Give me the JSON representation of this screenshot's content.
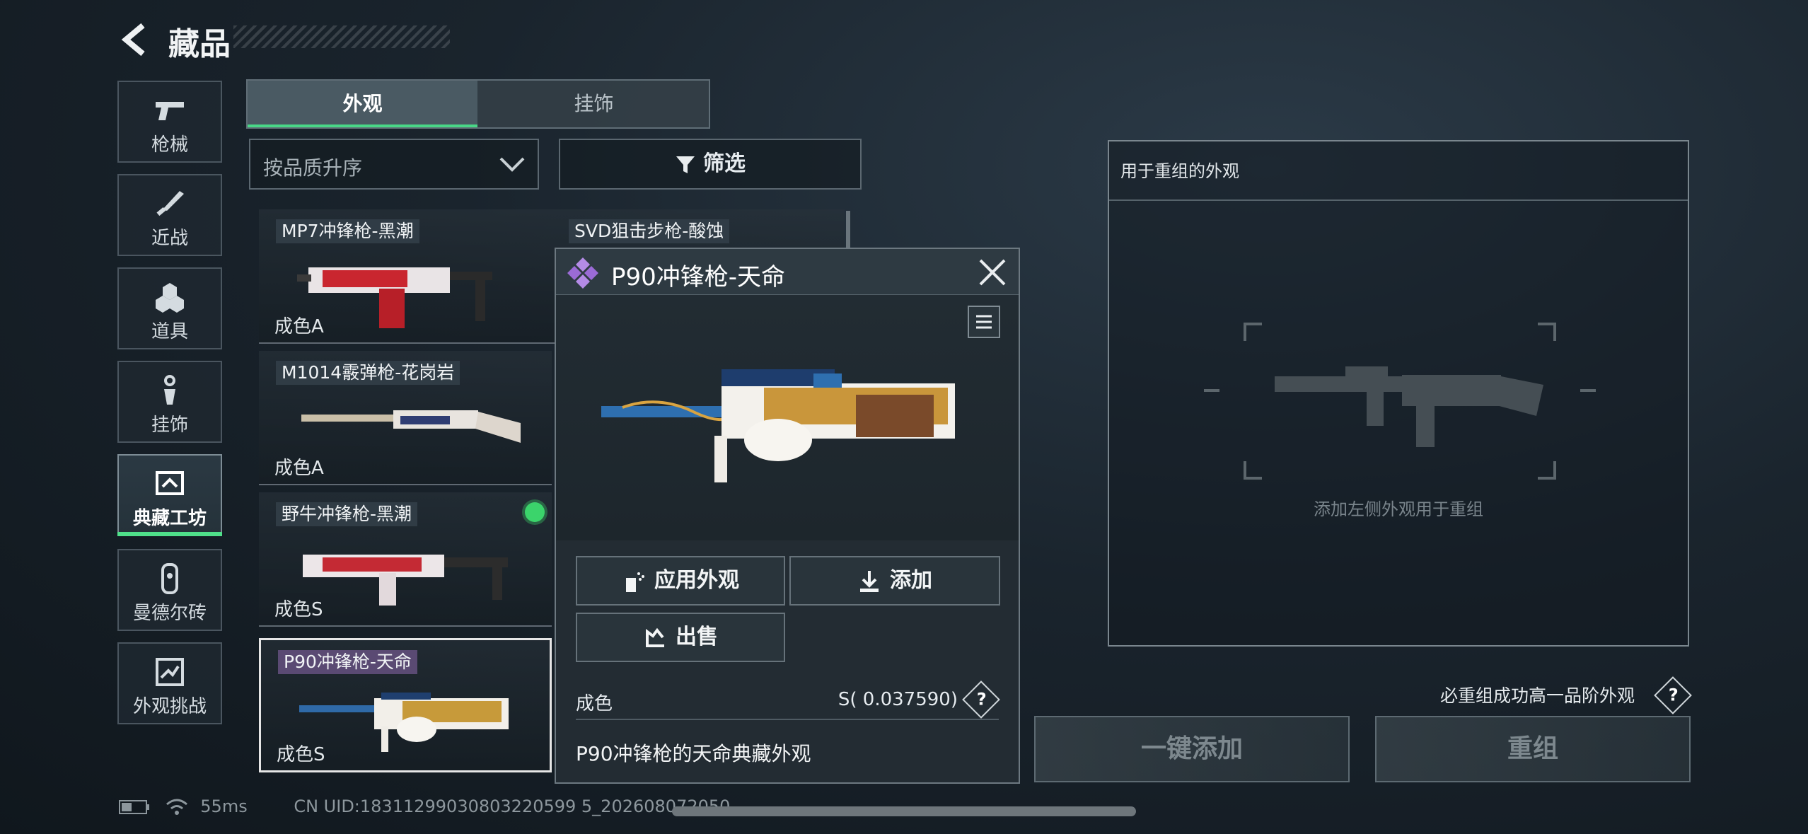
{
  "header": {
    "title": "藏品",
    "back_icon": "back-arrow-icon"
  },
  "sidebar": {
    "items": [
      {
        "label": "枪械",
        "icon": "pistol-icon"
      },
      {
        "label": "近战",
        "icon": "knife-icon"
      },
      {
        "label": "道具",
        "icon": "grenade-icon"
      },
      {
        "label": "挂饰",
        "icon": "keychain-icon"
      },
      {
        "label": "典藏工坊",
        "icon": "workshop-icon",
        "active": true
      },
      {
        "label": "曼德尔砖",
        "icon": "mandel-brick-icon"
      },
      {
        "label": "外观挑战",
        "icon": "challenge-icon"
      }
    ]
  },
  "tabs": [
    {
      "label": "外观",
      "active": true
    },
    {
      "label": "挂饰",
      "active": false
    }
  ],
  "sort": {
    "label": "按品质升序"
  },
  "filter": {
    "label": "筛选"
  },
  "skins": [
    {
      "name": "MP7冲锋枪-黑潮",
      "grade": "成色A"
    },
    {
      "name": "SVD狙击步枪-酸蚀",
      "grade": ""
    },
    {
      "name": "M1014霰弹枪-花岗岩",
      "grade": "成色A"
    },
    {
      "name": "野牛冲锋枪-黑潮",
      "grade": "成色S",
      "equipped": true
    },
    {
      "name": "P90冲锋枪-天命",
      "grade": "成色S",
      "selected": true
    }
  ],
  "detail": {
    "title": "P90冲锋枪-天命",
    "apply_label": "应用外观",
    "add_label": "添加",
    "sell_label": "出售",
    "grade_label": "成色",
    "grade_value": "S( 0.037590)",
    "description": "P90冲锋枪的天命典藏外观",
    "rarity_color": "#9b6bd6"
  },
  "remix": {
    "title": "用于重组的外观",
    "hint": "添加左侧外观用于重组",
    "rule_note": "必重组成功高一品阶外观",
    "add_all_label": "一键添加",
    "remix_label": "重组"
  },
  "status": {
    "ping": "55ms",
    "uid": "CN UID:18311299030803220599 5_202608072050"
  },
  "colors": {
    "accent_green": "#4fe08a",
    "equipped_dot": "#3bd46b",
    "selected_name_bg": "#5a4a73"
  }
}
